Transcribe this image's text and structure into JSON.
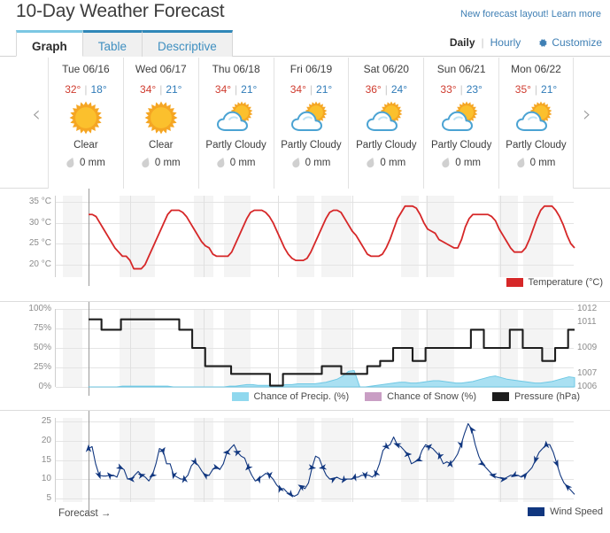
{
  "header": {
    "title": "10-Day Weather Forecast",
    "promo_text": "New forecast layout!",
    "promo_link": "Learn more"
  },
  "tabs": [
    {
      "label": "Graph",
      "active": true
    },
    {
      "label": "Table",
      "active": false
    },
    {
      "label": "Descriptive",
      "active": false
    }
  ],
  "view_controls": {
    "daily": "Daily",
    "separator": "|",
    "hourly": "Hourly",
    "customize": "Customize",
    "gear_icon": "gear-icon"
  },
  "nav": {
    "prev_icon": "chevron-left-icon",
    "prev_label": "‹",
    "next_icon": "chevron-right-icon",
    "next_label": "›"
  },
  "days": [
    {
      "name": "Tue 06/16",
      "high": "32°",
      "low": "18°",
      "condition": "Clear",
      "icon": "sun-icon",
      "precip": "0 mm"
    },
    {
      "name": "Wed 06/17",
      "high": "34°",
      "low": "21°",
      "condition": "Clear",
      "icon": "sun-icon",
      "precip": "0 mm"
    },
    {
      "name": "Thu 06/18",
      "high": "34°",
      "low": "21°",
      "condition": "Partly Cloudy",
      "icon": "sun-cloud-icon",
      "precip": "0 mm"
    },
    {
      "name": "Fri 06/19",
      "high": "34°",
      "low": "21°",
      "condition": "Partly Cloudy",
      "icon": "sun-cloud-icon",
      "precip": "0 mm"
    },
    {
      "name": "Sat 06/20",
      "high": "36°",
      "low": "24°",
      "condition": "Partly Cloudy",
      "icon": "sun-cloud-icon",
      "precip": "0 mm"
    },
    {
      "name": "Sun 06/21",
      "high": "33°",
      "low": "23°",
      "condition": "Partly Cloudy",
      "icon": "sun-cloud-icon",
      "precip": "0 mm"
    },
    {
      "name": "Mon 06/22",
      "high": "35°",
      "low": "21°",
      "condition": "Partly Cloudy",
      "icon": "sun-cloud-icon",
      "precip": "0 mm"
    }
  ],
  "sun_markers": [
    {
      "type": "sunrise",
      "x_pct": 5.6
    },
    {
      "type": "sunset",
      "x_pct": 22.2
    },
    {
      "type": "sunrise",
      "x_pct": 33.4
    },
    {
      "type": "sunset",
      "x_pct": 50.0
    },
    {
      "type": "sunrise",
      "x_pct": 61.2
    },
    {
      "type": "sunset",
      "x_pct": 77.8
    },
    {
      "type": "sunrise",
      "x_pct": 89.0
    }
  ],
  "forecast_marker": {
    "label": "Forecast →"
  },
  "colors": {
    "temperature": "#d62728",
    "precip": "#8fd8ee",
    "snow": "#c99ec4",
    "pressure": "#1d1d1d",
    "wind": "#10367f",
    "accent_link": "#3f7fb4",
    "tab_active_border": "#7cc7e3",
    "tab_border": "#2f87b8",
    "high_temp": "#cf3b2e",
    "low_temp": "#2f7bb8",
    "night_band": "#ededed"
  },
  "chart_data": [
    {
      "type": "line",
      "name": "temperature-chart",
      "title": "Temperature",
      "ylabel": "°C",
      "ytick_labels": [
        "35 °C",
        "30 °C",
        "25 °C",
        "20 °C"
      ],
      "yticks": [
        35,
        30,
        25,
        20
      ],
      "ylim": [
        17,
        36.5
      ],
      "grid": true,
      "legend_position": "bottom-right",
      "legend": [
        {
          "label": "Temperature (°C)",
          "color": "#d62728"
        }
      ],
      "series": [
        {
          "name": "Temperature (°C)",
          "color": "#d62728",
          "values": [
            32,
            32,
            31.5,
            30,
            28.5,
            27,
            25.5,
            24,
            23,
            22,
            22,
            21,
            19,
            19,
            19,
            20,
            22,
            24,
            26,
            28,
            30,
            32,
            33,
            33,
            33,
            32.5,
            31.5,
            30,
            28.5,
            27,
            25.5,
            24.5,
            24,
            22.5,
            22,
            22,
            22,
            22,
            23,
            25,
            27,
            29,
            31,
            32.5,
            33,
            33,
            33,
            32.5,
            31.5,
            30,
            28,
            26,
            24,
            22.5,
            21.5,
            21,
            21,
            21,
            21.5,
            23,
            25,
            27,
            29,
            31,
            32.5,
            33,
            33,
            32.5,
            31,
            29.5,
            28,
            27,
            25.5,
            24,
            22.5,
            22,
            22,
            22,
            22.5,
            24,
            26,
            28.5,
            31,
            32.5,
            34,
            34,
            34,
            33.5,
            32,
            30,
            28.5,
            28,
            27.5,
            26,
            25.5,
            25,
            24.5,
            24,
            24,
            26,
            29,
            31,
            32,
            32,
            32,
            32,
            32,
            31.5,
            30.5,
            28.5,
            27,
            25.5,
            24,
            23,
            23,
            23,
            24,
            26,
            28.5,
            31,
            33,
            34,
            34,
            34,
            33,
            31.5,
            29.5,
            27,
            25,
            24
          ]
        }
      ]
    },
    {
      "type": "line",
      "name": "precipitation-pressure-chart",
      "title": "Chance of Precipitation / Pressure",
      "ytick_labels_left": [
        "100%",
        "75%",
        "50%",
        "25%",
        "0%"
      ],
      "yticks_left": [
        100,
        75,
        50,
        25,
        0
      ],
      "ylim_left": [
        0,
        100
      ],
      "ytick_labels_right": [
        "1012",
        "1011",
        "1009",
        "1007",
        "1006"
      ],
      "yticks_right": [
        1012,
        1011,
        1009,
        1007,
        1006
      ],
      "ylim_right": [
        1006,
        1012
      ],
      "grid": true,
      "legend_position": "bottom-center",
      "legend": [
        {
          "label": "Chance of Precip. (%)",
          "color": "#8fd8ee"
        },
        {
          "label": "Chance of Snow (%)",
          "color": "#c99ec4"
        },
        {
          "label": "Pressure (hPa)",
          "color": "#1d1d1d"
        }
      ],
      "series": [
        {
          "name": "Pressure (hPa)",
          "color": "#1d1d1d",
          "axis": "right",
          "values": [
            1011.2,
            1011.2,
            1010.4,
            1010.4,
            1010.4,
            1011.2,
            1011.2,
            1011.2,
            1011.2,
            1011.2,
            1011.2,
            1011.2,
            1011.2,
            1011.2,
            1010.4,
            1010.4,
            1009.0,
            1009.0,
            1007.6,
            1007.6,
            1007.6,
            1007.6,
            1007.0,
            1007.0,
            1007.0,
            1007.0,
            1007.0,
            1007.0,
            1006.1,
            1006.1,
            1007.0,
            1007.0,
            1007.0,
            1007.0,
            1007.0,
            1007.0,
            1007.6,
            1007.6,
            1007.6,
            1007.0,
            1007.0,
            1007.0,
            1007.0,
            1007.6,
            1007.6,
            1008.0,
            1008.0,
            1009.0,
            1009.0,
            1009.0,
            1008.0,
            1008.0,
            1009.0,
            1009.0,
            1009.0,
            1009.0,
            1009.0,
            1009.0,
            1009.0,
            1010.4,
            1010.4,
            1009.0,
            1009.0,
            1009.0,
            1009.0,
            1010.4,
            1010.4,
            1009.0,
            1009.0,
            1009.0,
            1008.0,
            1008.0,
            1009.0,
            1009.0,
            1010.4
          ]
        },
        {
          "name": "Chance of Precip. (%)",
          "color": "#8fd8ee",
          "axis": "left",
          "values": [
            0,
            0,
            0,
            0,
            0,
            0,
            1,
            1,
            1,
            1,
            1,
            1,
            1,
            1,
            1,
            0,
            0,
            0,
            0,
            0,
            0,
            0,
            0,
            0,
            0,
            1,
            1,
            2,
            3,
            3,
            2,
            2,
            2,
            2,
            2,
            3,
            3,
            4,
            4,
            4,
            4,
            5,
            6,
            8,
            10,
            14,
            20,
            21,
            0,
            0,
            1,
            2,
            3,
            4,
            5,
            6,
            6,
            5,
            5,
            6,
            7,
            8,
            8,
            7,
            6,
            5,
            5,
            6,
            7,
            9,
            11,
            13,
            14,
            12,
            10,
            9,
            8,
            7,
            6,
            5,
            5,
            6,
            7,
            9,
            11,
            13,
            12
          ]
        },
        {
          "name": "Chance of Snow (%)",
          "color": "#c99ec4",
          "axis": "left",
          "values": [
            0,
            0,
            0,
            0,
            0,
            0,
            0,
            0,
            0,
            0,
            0,
            0,
            0,
            0,
            0,
            0,
            0,
            0,
            0,
            0
          ]
        }
      ]
    },
    {
      "type": "line",
      "name": "wind-speed-chart",
      "title": "Wind Speed",
      "ytick_labels": [
        "25",
        "20",
        "15",
        "10",
        "5"
      ],
      "yticks": [
        25,
        20,
        15,
        10,
        5
      ],
      "ylim": [
        4,
        26
      ],
      "grid": true,
      "legend_position": "bottom-right",
      "legend": [
        {
          "label": "Wind Speed",
          "color": "#10367f"
        }
      ],
      "series": [
        {
          "name": "Wind Speed",
          "color": "#10367f",
          "values": [
            18,
            18.5,
            14,
            11,
            10.8,
            10.8,
            11,
            11,
            10.5,
            13,
            12.5,
            10,
            10,
            11,
            12,
            11,
            10.5,
            9.5,
            11,
            14,
            18,
            17.5,
            14,
            14,
            11,
            10.5,
            10,
            10,
            11,
            13.5,
            14.5,
            13.5,
            12,
            11,
            11,
            12.5,
            13,
            12.5,
            14,
            17,
            18,
            19,
            17,
            16,
            15.5,
            13,
            11,
            9.5,
            10,
            10.8,
            11.5,
            11,
            10,
            8.5,
            7.5,
            7.5,
            6.5,
            6,
            5.5,
            6,
            8,
            7.5,
            9,
            13,
            16,
            15.5,
            13,
            11,
            10,
            10,
            10.5,
            10,
            9.8,
            10,
            10,
            10.5,
            10.5,
            11,
            11,
            11,
            10.5,
            11.5,
            14,
            17.5,
            18.5,
            19,
            21,
            19,
            18.5,
            17.5,
            16.5,
            14,
            14.5,
            15,
            17.5,
            19,
            18.5,
            18,
            17,
            16,
            14,
            14.5,
            14,
            15,
            16.5,
            19,
            22,
            24.5,
            23,
            19,
            16,
            14,
            13,
            12,
            11,
            10.5,
            10.3,
            10,
            10.5,
            11,
            11,
            11,
            10.5,
            11,
            12,
            13,
            15,
            17,
            18,
            19,
            19,
            17,
            14,
            11,
            9,
            8,
            7,
            6
          ]
        }
      ]
    }
  ]
}
